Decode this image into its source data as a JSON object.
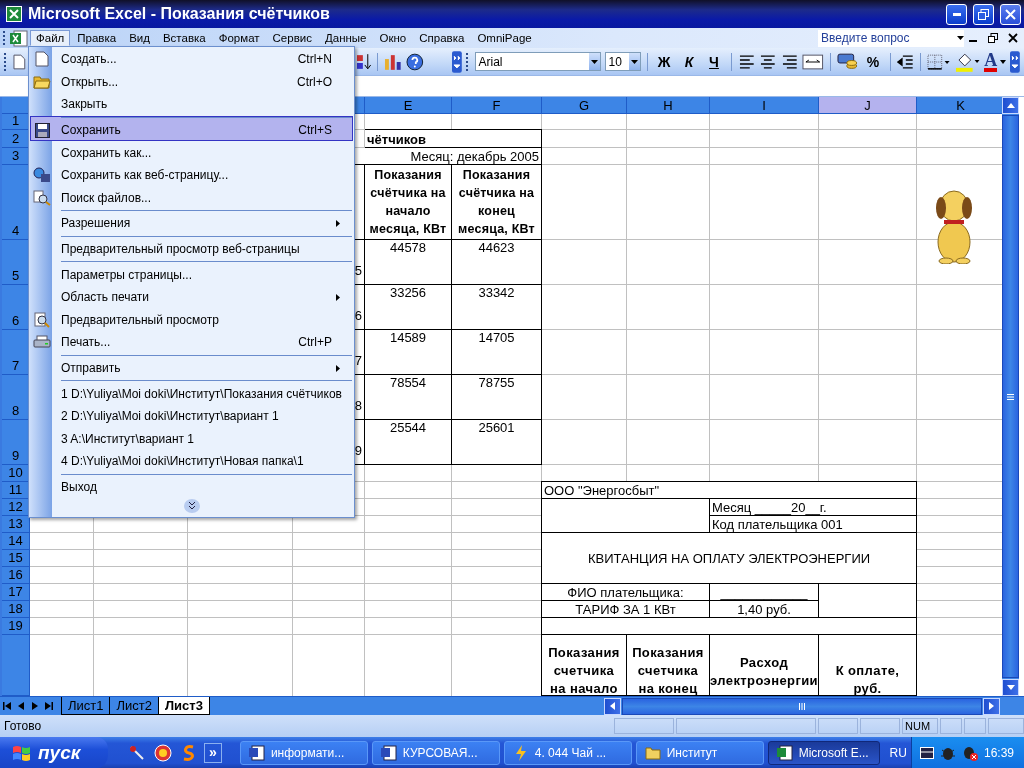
{
  "window": {
    "title": "Microsoft Excel - Показания счётчиков"
  },
  "menu_bar": {
    "items": [
      {
        "label": "Файл",
        "selected": true
      },
      {
        "label": "Правка",
        "selected": false
      },
      {
        "label": "Вид",
        "selected": false
      },
      {
        "label": "Вставка",
        "selected": false
      },
      {
        "label": "Формат",
        "selected": false
      },
      {
        "label": "Сервис",
        "selected": false
      },
      {
        "label": "Данные",
        "selected": false
      },
      {
        "label": "Окно",
        "selected": false
      },
      {
        "label": "Справка",
        "selected": false
      },
      {
        "label": "OmniPage",
        "selected": false
      }
    ],
    "help_field": {
      "placeholder": "Введите вопрос"
    }
  },
  "toolbar": {
    "font": "Arial",
    "size": "10",
    "bold": "Ж",
    "italic": "К",
    "underline": "Ч",
    "percent": "%",
    "font_color": "A"
  },
  "columns": [
    {
      "label": "E",
      "selected": false
    },
    {
      "label": "F",
      "selected": false
    },
    {
      "label": "G",
      "selected": false
    },
    {
      "label": "H",
      "selected": false
    },
    {
      "label": "I",
      "selected": false
    },
    {
      "label": "J",
      "selected": true
    },
    {
      "label": "K",
      "selected": false
    }
  ],
  "rows": [
    "1",
    "2",
    "3",
    "4",
    "5",
    "6",
    "7",
    "8",
    "9",
    "10",
    "11",
    "12",
    "13",
    "14",
    "15",
    "16",
    "17",
    "18",
    "19"
  ],
  "meter_table": {
    "title": "чётчиков",
    "month": "Месяц: декабрь 2005",
    "headers": [
      "Показания счётчика на начало месяца, КВт",
      "Показания счётчика на конец месяца, КВт"
    ],
    "rows": [
      {
        "column_d": "5",
        "start": "44578",
        "end": "44623"
      },
      {
        "column_d": "6",
        "start": "33256",
        "end": "33342"
      },
      {
        "column_d": "7",
        "start": "14589",
        "end": "14705"
      },
      {
        "column_d": "8",
        "start": "78554",
        "end": "78755"
      },
      {
        "column_d": "9",
        "start": "25544",
        "end": "25601"
      }
    ]
  },
  "receipt": {
    "company": "ООО \"Энергосбыт\"",
    "month": "Месяц _____20__г.",
    "payer_code": "Код плательщика 001",
    "title": "КВИТАНЦИЯ НА ОПЛАТУ ЭЛЕКТРОЭНЕРГИИ",
    "name_label": "ФИО плательщика:",
    "name_value": "____________",
    "tariff_label": "ТАРИФ ЗА 1 КВт",
    "tariff_value": "1,40 руб.",
    "headers": [
      "Показания счетчика на начало",
      "Показания счетчика на конец",
      "Расход электроэнергии",
      "К оплате, руб."
    ]
  },
  "file_menu": {
    "items": [
      {
        "label": "Создать...",
        "shortcut": "Ctrl+N",
        "selected": false,
        "divider_before": false,
        "submenu": false
      },
      {
        "label": "Открыть...",
        "shortcut": "Ctrl+O",
        "selected": false,
        "divider_before": false,
        "submenu": false
      },
      {
        "label": "Закрыть",
        "selected": false,
        "divider_before": false,
        "submenu": false
      },
      {
        "label": "Сохранить",
        "shortcut": "Ctrl+S",
        "selected": true,
        "divider_before": true,
        "submenu": false
      },
      {
        "label": "Сохранить как...",
        "selected": false,
        "divider_before": false,
        "submenu": false
      },
      {
        "label": "Сохранить как веб-страницу...",
        "selected": false,
        "divider_before": false,
        "submenu": false
      },
      {
        "label": "Поиск файлов...",
        "selected": false,
        "divider_before": false,
        "submenu": false
      },
      {
        "label": "Разрешения",
        "selected": false,
        "divider_before": true,
        "submenu": true
      },
      {
        "label": "Предварительный просмотр веб-страницы",
        "selected": false,
        "divider_before": true,
        "submenu": false
      },
      {
        "label": "Параметры страницы...",
        "selected": false,
        "divider_before": true,
        "submenu": false
      },
      {
        "label": "Область печати",
        "selected": false,
        "divider_before": false,
        "submenu": true
      },
      {
        "label": "Предварительный просмотр",
        "selected": false,
        "divider_before": false,
        "submenu": false
      },
      {
        "label": "Печать...",
        "shortcut": "Ctrl+P",
        "selected": false,
        "divider_before": false,
        "submenu": false
      },
      {
        "label": "Отправить",
        "selected": false,
        "divider_before": true,
        "submenu": true
      },
      {
        "label": "1 D:\\Yuliya\\Moi doki\\Институт\\Показания счётчиков",
        "selected": false,
        "divider_before": true,
        "submenu": false
      },
      {
        "label": "2 D:\\Yuliya\\Moi doki\\Институт\\вариант 1",
        "selected": false,
        "divider_before": false,
        "submenu": false
      },
      {
        "label": "3 A:\\Институт\\вариант 1",
        "selected": false,
        "divider_before": false,
        "submenu": false
      },
      {
        "label": "4 D:\\Yuliya\\Moi doki\\Институт\\Новая папка\\1",
        "selected": false,
        "divider_before": false,
        "submenu": false
      },
      {
        "label": "Выход",
        "selected": false,
        "divider_before": true,
        "submenu": false
      }
    ]
  },
  "sheet_tabs": [
    {
      "label": "Лист1",
      "selected": false
    },
    {
      "label": "Лист2",
      "selected": false
    },
    {
      "label": "Лист3",
      "selected": true
    }
  ],
  "status_bar": {
    "text": "Готово",
    "num": "NUM"
  },
  "taskbar": {
    "start": "пуск",
    "more": "»",
    "tasks": [
      {
        "label": "информати...",
        "selected": false
      },
      {
        "label": "КУРСОВАЯ...",
        "selected": false
      },
      {
        "label": "4. 044 Чай ...",
        "selected": false
      },
      {
        "label": "Институт",
        "selected": false
      },
      {
        "label": "Microsoft E...",
        "selected": true
      }
    ],
    "language": "RU",
    "clock": "16:39"
  }
}
